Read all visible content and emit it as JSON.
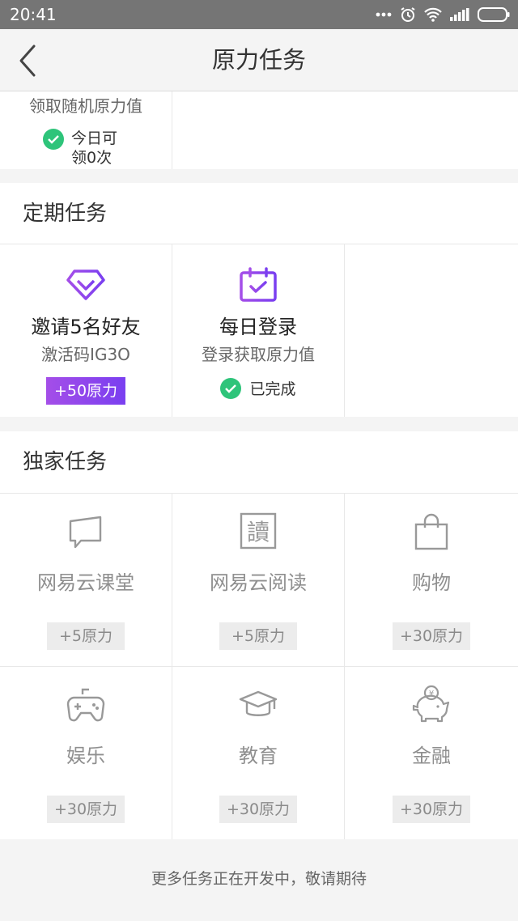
{
  "status_bar": {
    "time": "20:41",
    "icons": [
      "more-icon",
      "alarm-icon",
      "wifi-icon",
      "signal-icon",
      "battery-icon"
    ]
  },
  "nav": {
    "title": "原力任务",
    "back_icon": "chevron-left-icon"
  },
  "top_partial": {
    "subtitle": "领取随机原力值",
    "status_line1": "今日可",
    "status_line2": "领0次"
  },
  "periodic": {
    "title": "定期任务",
    "items": [
      {
        "icon": "diamond-icon",
        "name": "邀请5名好友",
        "sub": "激活码IG3O",
        "reward": "+50原力"
      },
      {
        "icon": "calendar-check-icon",
        "name": "每日登录",
        "sub": "登录获取原力值",
        "status": "已完成"
      }
    ]
  },
  "exclusive": {
    "title": "独家任务",
    "items": [
      {
        "icon": "chat-icon",
        "name": "网易云课堂",
        "reward": "+5原力"
      },
      {
        "icon": "read-icon",
        "name": "网易云阅读",
        "reward": "+5原力"
      },
      {
        "icon": "shopping-bag-icon",
        "name": "购物",
        "reward": "+30原力"
      },
      {
        "icon": "gamepad-icon",
        "name": "娱乐",
        "reward": "+30原力"
      },
      {
        "icon": "graduation-cap-icon",
        "name": "教育",
        "reward": "+30原力"
      },
      {
        "icon": "piggy-bank-icon",
        "name": "金融",
        "reward": "+30原力"
      }
    ]
  },
  "footer": {
    "text": "更多任务正在开发中，敬请期待"
  },
  "colors": {
    "accent_purple": "#8b45ee",
    "success_green": "#2ec47a",
    "muted_grey": "#8f8f8f"
  }
}
